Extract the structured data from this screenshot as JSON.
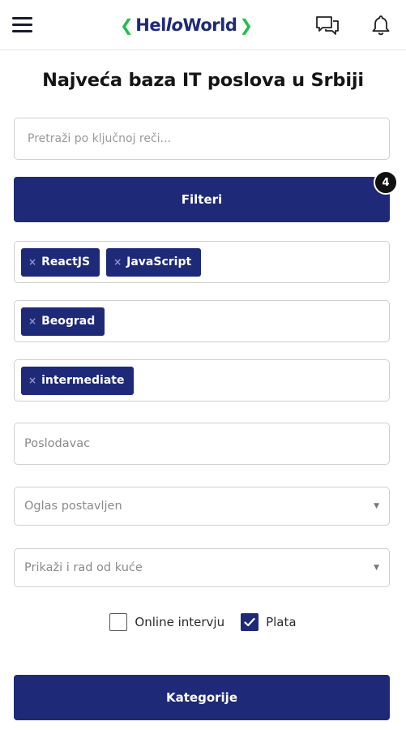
{
  "header": {
    "logo_left_bracket": "❮",
    "logo_hello": "Hel",
    "logo_ll_italic": "lo",
    "logo_world": "World",
    "logo_right_bracket": "❯",
    "icons": [
      "menu-icon",
      "chat-icon",
      "bell-icon"
    ]
  },
  "main": {
    "title": "Najveća baza IT poslova u Srbiji",
    "search_placeholder": "Pretraži po ključnoj reči...",
    "filters_label": "Filteri",
    "filters_count": "4",
    "tech_tags": [
      "ReactJS",
      "JavaScript"
    ],
    "location_tags": [
      "Beograd"
    ],
    "level_tags": [
      "intermediate"
    ],
    "employer_placeholder": "Poslodavac",
    "posted_select": "Oglas postavljen",
    "remote_select": "Prikaži i rad od kuće",
    "online_interview_label": "Online intervju",
    "online_interview_checked": false,
    "salary_label": "Plata",
    "salary_checked": true,
    "categories_label": "Kategorije",
    "tag_remove_glyph": "×"
  },
  "colors": {
    "brand_navy": "#1e2a78",
    "brand_green": "#20c04f",
    "badge_black": "#111111"
  }
}
